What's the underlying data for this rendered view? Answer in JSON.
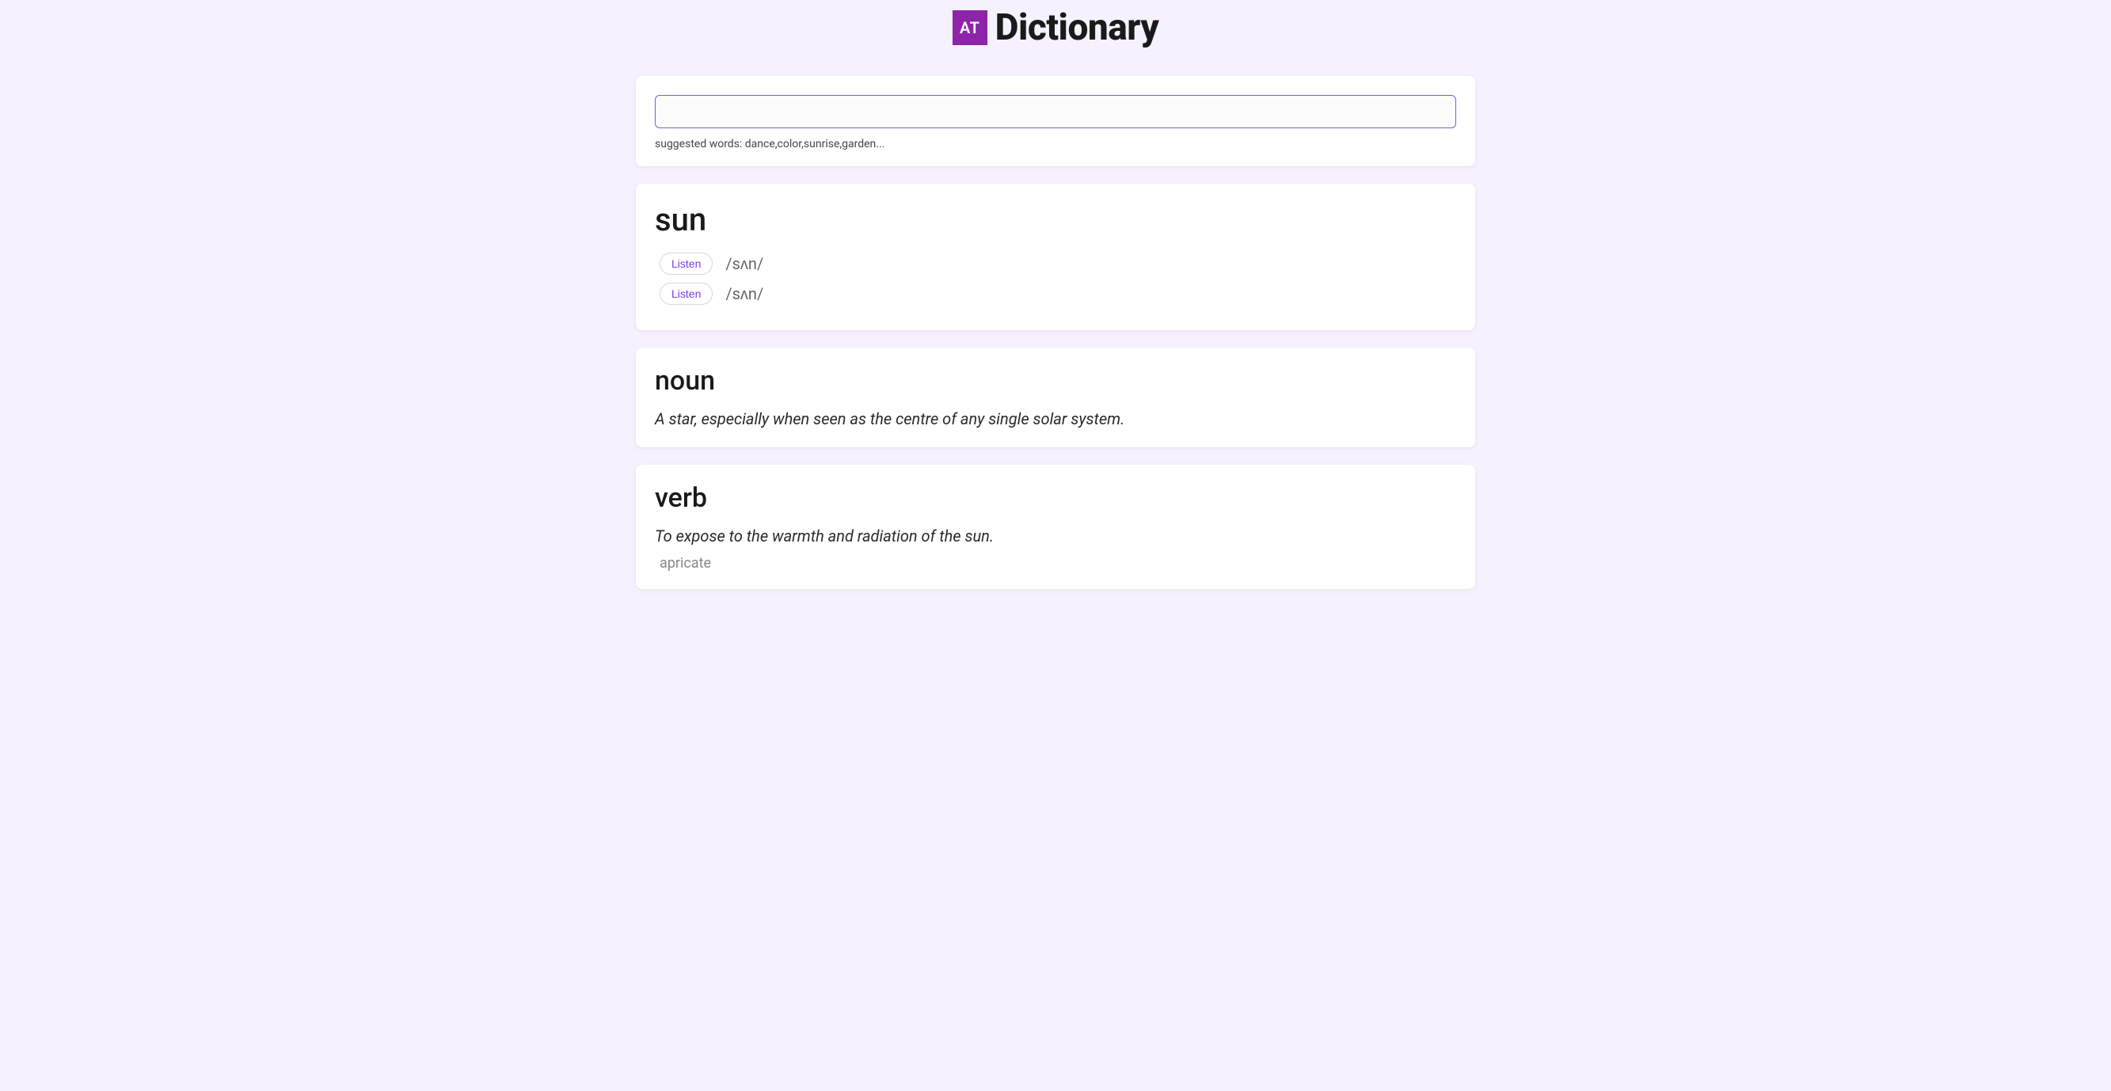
{
  "header": {
    "logo_badge": "AT",
    "title": "Dictionary"
  },
  "search": {
    "value": "",
    "suggested_label": "suggested words: dance,color,sunrise,garden..."
  },
  "entry": {
    "word": "sun",
    "phonetics": [
      {
        "listen_label": "Listen",
        "text": "/sʌn/"
      },
      {
        "listen_label": "Listen",
        "text": "/sʌn/"
      }
    ],
    "meanings": [
      {
        "part_of_speech": "noun",
        "definition": "A star, especially when seen as the centre of any single solar system.",
        "synonym": ""
      },
      {
        "part_of_speech": "verb",
        "definition": "To expose to the warmth and radiation of the sun.",
        "synonym": "apricate"
      }
    ]
  }
}
